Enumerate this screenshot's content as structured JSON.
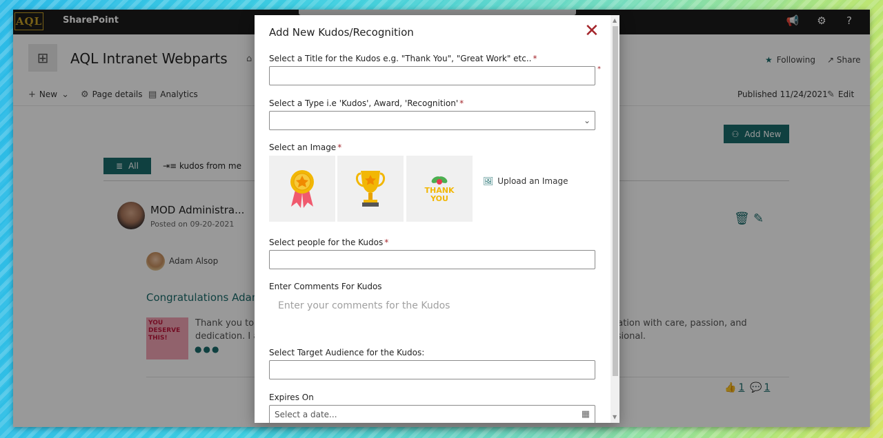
{
  "suite": {
    "logo": "AQL",
    "title": "SharePoint"
  },
  "site": {
    "title": "AQL Intranet Webparts",
    "following_label": "Following",
    "share_label": "Share"
  },
  "commandbar": {
    "new_label": "New",
    "page_details_label": "Page details",
    "analytics_label": "Analytics",
    "published_label": "Published 11/24/2021",
    "edit_label": "Edit"
  },
  "kudos_list": {
    "add_new_label": "Add New",
    "tabs": [
      {
        "label": "All"
      },
      {
        "label": "kudos from me"
      }
    ],
    "post": {
      "author": "MOD Administra...",
      "date": "Posted on 09-20-2021",
      "recipient": "Adam Alsop",
      "title": "Congratulations Adam",
      "thumbnail_text": "YOU DESERVE THIS!",
      "body_left_1": "Thank you to o",
      "body_left_2": "dedication. I a",
      "body_right_1": "uation with care, passion, and",
      "body_right_2": "ssional.",
      "likes": "1",
      "comments": "1"
    }
  },
  "modal": {
    "title": "Add New Kudos/Recognition",
    "title_field_label": "Select a Title for the Kudos e.g. \"Thank You\", \"Great Work\" etc..",
    "type_field_label": "Select a Type i.e 'Kudos', Award, 'Recognition'",
    "image_field_label": "Select an Image",
    "images": [
      {
        "name": "medal"
      },
      {
        "name": "trophy"
      },
      {
        "name": "thank-you",
        "text_line1": "THANK",
        "text_line2": "YOU"
      }
    ],
    "upload_label": "Upload an Image",
    "people_field_label": "Select people for the Kudos",
    "comments_field_label": "Enter Comments For Kudos",
    "comments_placeholder": "Enter your comments for the Kudos",
    "audience_field_label": "Select Target Audience for the Kudos:",
    "expires_field_label": "Expires On",
    "date_placeholder": "Select a date...",
    "required_mark": "*"
  },
  "colors": {
    "accent": "#1a6b6b",
    "required": "#a4262c",
    "suitebar": "#1b1b1b"
  }
}
